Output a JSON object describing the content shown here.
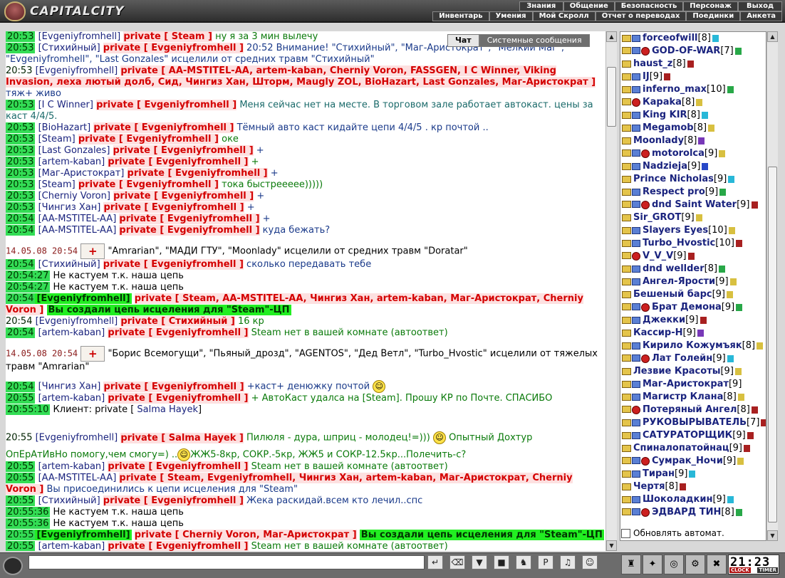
{
  "app": {
    "title": "CAPITALCITY"
  },
  "menu_top": [
    "Знания",
    "Общение",
    "Безопасность",
    "Персонаж",
    "Выход"
  ],
  "menu_bottom": [
    "Инвентарь",
    "Умения",
    "Мой Скролл",
    "Отчет о переводах",
    "Поединки",
    "Анкета"
  ],
  "tabs": {
    "chat": "Чат",
    "system": "Системные сообщения"
  },
  "chat": {
    "l1": {
      "time": "20:53",
      "speaker": "[Evgeniyfromhell]",
      "priv": "private [ Steam ]",
      "msg": "ну я за 3 мин вылечу"
    },
    "l2": {
      "time": "20:53",
      "speaker": "[Стихийный]",
      "priv": "private [ Evgeniyfromhell ]",
      "msg": "20:52 Внимание! \"Стихийный\", \"Маг-Аристократ\", \"Мелкий Маг\", \"Evgeniyfromhell\", \"Last Gonzales\" исцелили от средних травм \"Стихийный\""
    },
    "l3": {
      "time": "20:53",
      "speaker": "[Evgeniyfromhell]",
      "priv": "private [ AA-MSTITEL-AA, artem-kaban, Cherniy Voron, FASSGEN, I C Winner, Viking Invasion, леха лютый долб, Сид, Чингиз Хан, Шторм, Maugly ZOL, BioHazart, Last Gonzales, Маг-Аристократ ]",
      "msg": "тяж+ живо"
    },
    "l4": {
      "time": "20:53",
      "speaker": "[I C Winner]",
      "priv": "private [ Evgeniyfromhell ]",
      "msg": "Меня сейчас нет на месте. В торговом зале работает автокаст. цены за каст 4/4/5."
    },
    "l5": {
      "time": "20:53",
      "speaker": "[BioHazart]",
      "priv": "private [ Evgeniyfromhell ]",
      "msg": "Тёмный авто каст кидайте цепи 4/4/5 . кр почтой .."
    },
    "l6": {
      "time": "20:53",
      "speaker": "[Steam]",
      "priv": "private [ Evgeniyfromhell ]",
      "msg": "оке"
    },
    "l7": {
      "time": "20:53",
      "speaker": "[Last Gonzales]",
      "priv": "private [ Evgeniyfromhell ]",
      "msg": "+"
    },
    "l8": {
      "time": "20:53",
      "speaker": "[artem-kaban]",
      "priv": "private [ Evgeniyfromhell ]",
      "msg": "+"
    },
    "l9": {
      "time": "20:53",
      "speaker": "[Маг-Аристократ]",
      "priv": "private [ Evgeniyfromhell ]",
      "msg": "+"
    },
    "l10": {
      "time": "20:53",
      "speaker": "[Steam]",
      "priv": "private [ Evgeniyfromhell ]",
      "msg": "тока быстрееееe)))))"
    },
    "l11": {
      "time": "20:53",
      "speaker": "[Cherniy Voron]",
      "priv": "private [ Evgeniyfromhell ]",
      "msg": "+"
    },
    "l12": {
      "time": "20:53",
      "speaker": "[Чингиз Хан]",
      "priv": "private [ Evgeniyfromhell ]",
      "msg": "+"
    },
    "l13": {
      "time": "20:54",
      "speaker": "[AA-MSTITEL-AA]",
      "priv": "private [ Evgeniyfromhell ]",
      "msg": "+"
    },
    "l14": {
      "time": "20:54",
      "speaker": "[AA-MSTITEL-AA]",
      "priv": "private [ Evgeniyfromhell ]",
      "msg": "куда бежать?"
    },
    "s1": {
      "date": "14.05.08 20:54",
      "text": "\"Amrarian\", \"МАДИ ГТУ\", \"Moonlady\" исцелили от средних травм \"Doratar\""
    },
    "l15": {
      "time": "20:54",
      "speaker": "[Стихийный]",
      "priv": "private [ Evgeniyfromhell ]",
      "msg": "сколько передавать тебе"
    },
    "l16": {
      "time": "20:54:27",
      "msg": "Не кастуем т.к. наша цепь"
    },
    "l17": {
      "time": "20:54:27",
      "msg": "Не кастуем т.к. наша цепь"
    },
    "l18": {
      "time": "20:54",
      "speaker": "[Evgeniyfromhell]",
      "priv": "private [ Steam, AA-MSTITEL-AA, Чингиз Хан, artem-kaban, Маг-Аристократ, Cherniy Voron ]",
      "msg": "Вы создали цепь исцеления для \"Steam\"-ЦП"
    },
    "l19": {
      "time": "20:54",
      "speaker": "[Evgeniyfromhell]",
      "priv": "private [ Стихийный ]",
      "msg": "16 кр"
    },
    "l20": {
      "time": "20:54",
      "speaker": "[artem-kaban]",
      "priv": "private [ Evgeniyfromhell ]",
      "msg": "Steam нет в вашей комнате (автоответ)"
    },
    "s2": {
      "date": "14.05.08 20:54",
      "text": "\"Борис Всемогущи\", \"Пьяный_дрозд\", \"AGENTOS\", \"Дед Ветл\", \"Turbo_Hvostic\" исцелили от тяжелых травм \"Amrarian\""
    },
    "l21": {
      "time": "20:54",
      "speaker": "[Чингиз Хан]",
      "priv": "private [ Evgeniyfromhell ]",
      "msg": "+каст+ денюжку почтой"
    },
    "l22": {
      "time": "20:55",
      "speaker": "[artem-kaban]",
      "priv": "private [ Evgeniyfromhell ]",
      "msg": "+ АвтоКаст удалса на [Steam]. Прошу КР по Почте. СПАСИБО"
    },
    "l23": {
      "time": "20:55:10",
      "msg": "Клиент: private [",
      "name": "Salma Hayek",
      "end": "]"
    },
    "l24": {
      "time": "20:55",
      "speaker": "[Evgeniyfromhell]",
      "priv": "private [ Salma Hayek ]",
      "msg": "Пилюля - дура, шприц - молодец!=)))",
      "msg2": "Опытный Дохтур",
      "msg3": "ОпЕрАтИвНо помогу,чем смогу=) ..",
      "msg4": "ЖЖ5-8кр, СОКР.-5кр, ЖЖ5 и СОКР-12.5кр...Полечить-с?"
    },
    "l25": {
      "time": "20:55",
      "speaker": "[artem-kaban]",
      "priv": "private [ Evgeniyfromhell ]",
      "msg": "Steam нет в вашей комнате (автоответ)"
    },
    "l26": {
      "time": "20:55",
      "speaker": "[AA-MSTITEL-AA]",
      "priv": "private [ Steam, Evgeniyfromhell, Чингиз Хан, artem-kaban, Маг-Аристократ, Cherniy Voron ]",
      "msg": "Вы присоединились к цепи исцеления для \"Steam\""
    },
    "l27": {
      "time": "20:55",
      "speaker": "[Стихийный]",
      "priv": "private [ Evgeniyfromhell ]",
      "msg": "Жека раскидай.всем кто лечил..спс"
    },
    "l28": {
      "time": "20:55:36",
      "msg": "Не кастуем т.к. наша цепь"
    },
    "l29": {
      "time": "20:55:36",
      "msg": "Не кастуем т.к. наша цепь"
    },
    "l30": {
      "time": "20:55",
      "speaker": "[Evgeniyfromhell]",
      "priv": "private [ Cherniy Voron, Маг-Аристократ ]",
      "msg": "Вы создали цепь исцеления для \"Steam\"-ЦП"
    },
    "l31": {
      "time": "20:55",
      "speaker": "[artem-kaban]",
      "priv": "private [ Evgeniyfromhell ]",
      "msg": "Steam нет в вашей комнате (автоответ)"
    }
  },
  "users": [
    {
      "name": "forceofwill",
      "lvl": "[8]",
      "badge": "cyan"
    },
    {
      "name": "GOD-OF-WAR",
      "lvl": "[7]",
      "badge": "green"
    },
    {
      "name": "haust_z",
      "lvl": "[8]",
      "badge": "red"
    },
    {
      "name": "IJ",
      "lvl": "[9]",
      "badge": "red"
    },
    {
      "name": "inferno_max",
      "lvl": "[10]",
      "badge": "green"
    },
    {
      "name": "Караka",
      "lvl": "[8]",
      "badge": "yellow"
    },
    {
      "name": "King KIR",
      "lvl": "[8]",
      "badge": "cyan"
    },
    {
      "name": "Megamob",
      "lvl": "[8]",
      "badge": "yellow"
    },
    {
      "name": "Moonlady",
      "lvl": "[8]",
      "badge": "purple"
    },
    {
      "name": "motorolca",
      "lvl": "[9]",
      "badge": "yellow"
    },
    {
      "name": "Nadzieja",
      "lvl": "[9]",
      "badge": "blue"
    },
    {
      "name": "Prince Nicholas",
      "lvl": "[9]",
      "badge": "cyan"
    },
    {
      "name": "Respect pro",
      "lvl": "[9]",
      "badge": "green"
    },
    {
      "name": "dnd Saint Water",
      "lvl": "[9]",
      "badge": "red"
    },
    {
      "name": "Sir_GROT",
      "lvl": "[9]",
      "badge": "yellow"
    },
    {
      "name": "Slayers Eyes",
      "lvl": "[10]",
      "badge": "yellow"
    },
    {
      "name": "Turbo_Hvostic",
      "lvl": "[10]",
      "badge": "red"
    },
    {
      "name": "V_V_V",
      "lvl": "[9]",
      "badge": "red"
    },
    {
      "name": "dnd wellder",
      "lvl": "[8]",
      "badge": "green"
    },
    {
      "name": "Ангел-Ярости",
      "lvl": "[9]",
      "badge": "yellow"
    },
    {
      "name": "Бешеный барс",
      "lvl": "[9]",
      "badge": "yellow"
    },
    {
      "name": "Брат Демона",
      "lvl": "[9]",
      "badge": "green"
    },
    {
      "name": "Джекки",
      "lvl": "[9]",
      "badge": "red"
    },
    {
      "name": "Кассир-Н",
      "lvl": "[9]",
      "badge": "purple"
    },
    {
      "name": "Кирило Кожумъяк",
      "lvl": "[8]",
      "badge": "yellow"
    },
    {
      "name": "Лат Голейн",
      "lvl": "[9]",
      "badge": "cyan"
    },
    {
      "name": "Лезвие Красоты",
      "lvl": "[9]",
      "badge": "yellow"
    },
    {
      "name": "Маг-Аристократ",
      "lvl": "[9]",
      "badge": ""
    },
    {
      "name": "Магистр Клана",
      "lvl": "[8]",
      "badge": "yellow"
    },
    {
      "name": "Потеряный Ангел",
      "lvl": "[8]",
      "badge": "red"
    },
    {
      "name": "РУКОВЫРЫВАТЕЛЬ",
      "lvl": "[7]",
      "badge": "red"
    },
    {
      "name": "САТУРАТОРЩИК",
      "lvl": "[9]",
      "badge": "red"
    },
    {
      "name": "Спиналопатойнац",
      "lvl": "[9]",
      "badge": "red"
    },
    {
      "name": "Сумрак_Ночи",
      "lvl": "[9]",
      "badge": "yellow"
    },
    {
      "name": "Тиран",
      "lvl": "[9]",
      "badge": "cyan"
    },
    {
      "name": "Чертя",
      "lvl": "[8]",
      "badge": "red"
    },
    {
      "name": "Шоколадкин",
      "lvl": "[9]",
      "badge": "cyan"
    },
    {
      "name": "ЭДВАРД ТИН",
      "lvl": "[8]",
      "badge": "green"
    }
  ],
  "side": {
    "autoupdate_label": "Обновлять автомат."
  },
  "clock": {
    "time": "21:23",
    "label_left": "CLOCK",
    "label_right": "TIMER"
  },
  "toolbar_icons": [
    "enter-icon",
    "eraser-icon",
    "filter-icon",
    "save-icon",
    "runner-icon",
    "translit-icon",
    "music-icon",
    "smiley-icon"
  ],
  "panel_icons": [
    "inventory-icon",
    "skills-icon",
    "map-icon",
    "settings-icon",
    "exit-icon"
  ]
}
